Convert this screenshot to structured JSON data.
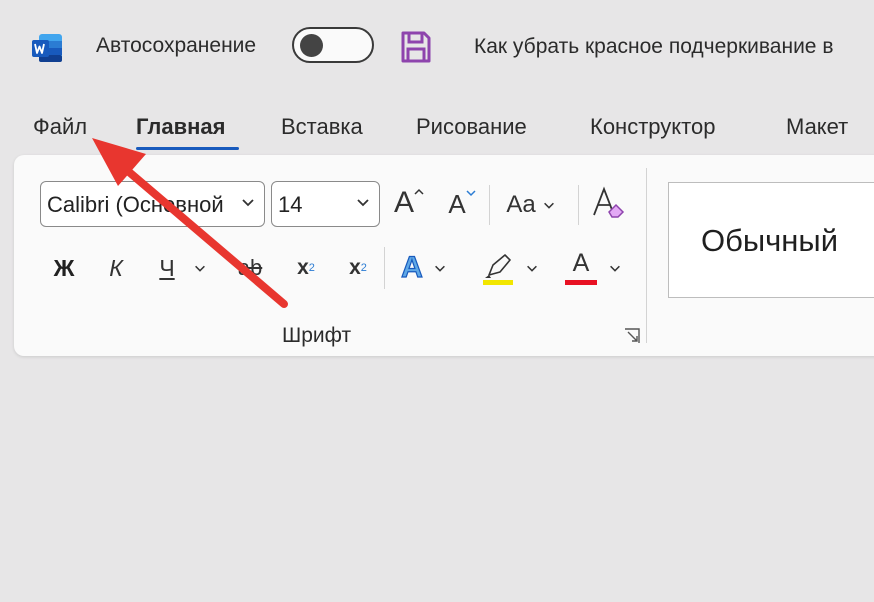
{
  "titlebar": {
    "app_icon": "word-icon",
    "autosave_label": "Автосохранение",
    "autosave_on": false,
    "save_icon": "save-icon",
    "document_title": "Как убрать красное подчеркивание в"
  },
  "tabs": [
    {
      "label": "Файл",
      "active": false
    },
    {
      "label": "Главная",
      "active": true
    },
    {
      "label": "Вставка",
      "active": false
    },
    {
      "label": "Рисование",
      "active": false
    },
    {
      "label": "Конструктор",
      "active": false
    },
    {
      "label": "Макет",
      "active": false
    }
  ],
  "font_group": {
    "font_name": "Calibri (Основной",
    "font_size": "14",
    "grow_font_glyph": "A",
    "shrink_font_glyph": "A",
    "change_case_label": "Aa",
    "bold_label": "Ж",
    "italic_label": "К",
    "underline_label": "Ч",
    "strikethrough_label": "ab",
    "subscript_label": "x",
    "subscript_index": "2",
    "superscript_label": "x",
    "superscript_index": "2",
    "text_effects_label": "A",
    "font_color_label": "A",
    "highlight_color": "#f2e600",
    "font_color": "#e81123",
    "group_label": "Шрифт"
  },
  "styles": {
    "first_style": "Обычный"
  },
  "annotation": {
    "arrow_color": "#e8362f",
    "target": "tab-file"
  }
}
